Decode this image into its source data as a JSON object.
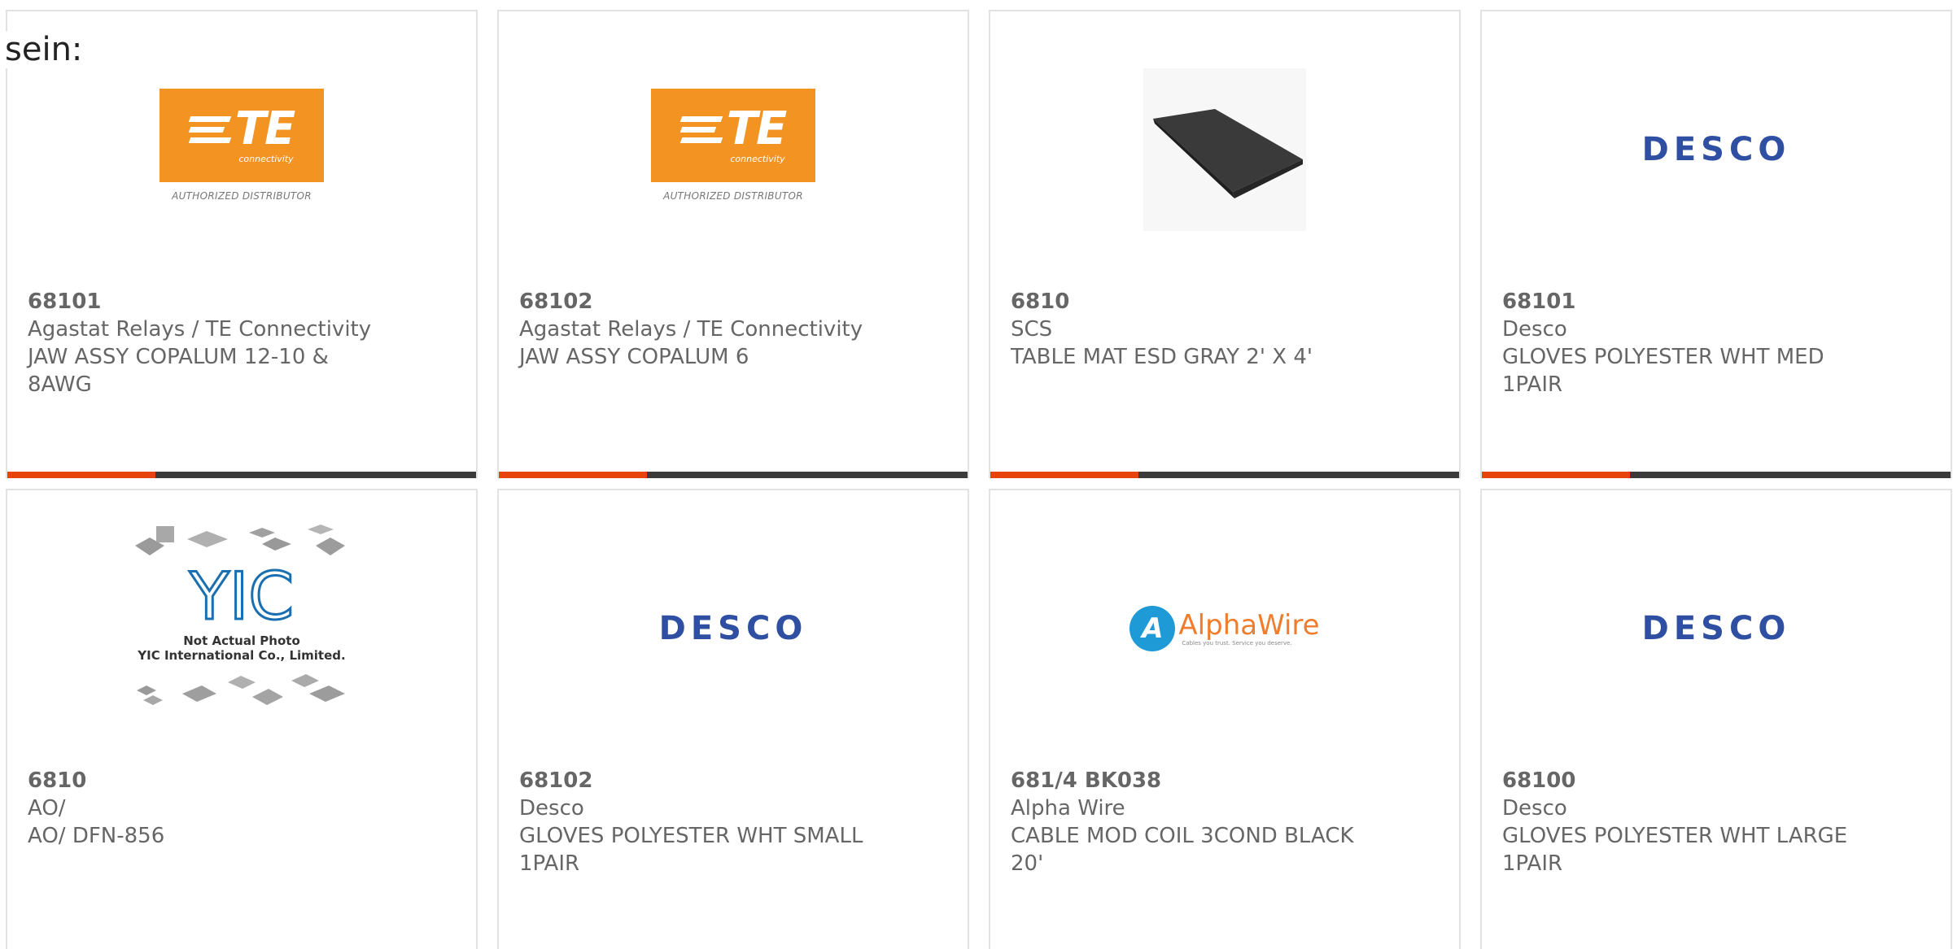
{
  "lead_text": "sein:",
  "colors": {
    "accent": "#e8420d",
    "bar": "#3b3b3b",
    "te_orange": "#f39322",
    "desco_blue": "#2f4fa3",
    "alpha_blue": "#1e9ad6",
    "alpha_orange": "#ef7d2d"
  },
  "logos": {
    "te": {
      "mark": "TE",
      "sub": "connectivity",
      "dist": "AUTHORIZED DISTRIBUTOR"
    },
    "desco": "DESCO",
    "yic": {
      "line1": "Not Actual Photo",
      "line2": "YIC International Co., Limited."
    },
    "alpha": {
      "name": "AlphaWire",
      "tag": "Cables you trust. Service you deserve."
    }
  },
  "products": [
    {
      "pn": "68101",
      "maker": "Agastat Relays / TE Connectivity",
      "desc": "JAW ASSY COPALUM 12-10 &",
      "desc2": "8AWG",
      "icon": "te-logo"
    },
    {
      "pn": "68102",
      "maker": "Agastat Relays / TE Connectivity",
      "desc": "JAW ASSY COPALUM 6",
      "desc2": "",
      "icon": "te-logo"
    },
    {
      "pn": "6810",
      "maker": "SCS",
      "desc": "TABLE MAT ESD GRAY 2' X 4'",
      "desc2": "",
      "icon": "table-mat-image"
    },
    {
      "pn": "68101",
      "maker": "Desco",
      "desc": "GLOVES POLYESTER WHT MED",
      "desc2": "1PAIR",
      "icon": "desco-logo"
    },
    {
      "pn": "6810",
      "maker": "AO/",
      "desc": "AO/ DFN-856",
      "desc2": "",
      "icon": "yic-placeholder"
    },
    {
      "pn": "68102",
      "maker": "Desco",
      "desc": "GLOVES POLYESTER WHT SMALL",
      "desc2": "1PAIR",
      "icon": "desco-logo"
    },
    {
      "pn": "681/4 BK038",
      "maker": "Alpha Wire",
      "desc": "CABLE MOD COIL 3COND BLACK",
      "desc2": "20'",
      "icon": "alphawire-logo"
    },
    {
      "pn": "68100",
      "maker": "Desco",
      "desc": "GLOVES POLYESTER WHT LARGE",
      "desc2": "1PAIR",
      "icon": "desco-logo"
    }
  ]
}
